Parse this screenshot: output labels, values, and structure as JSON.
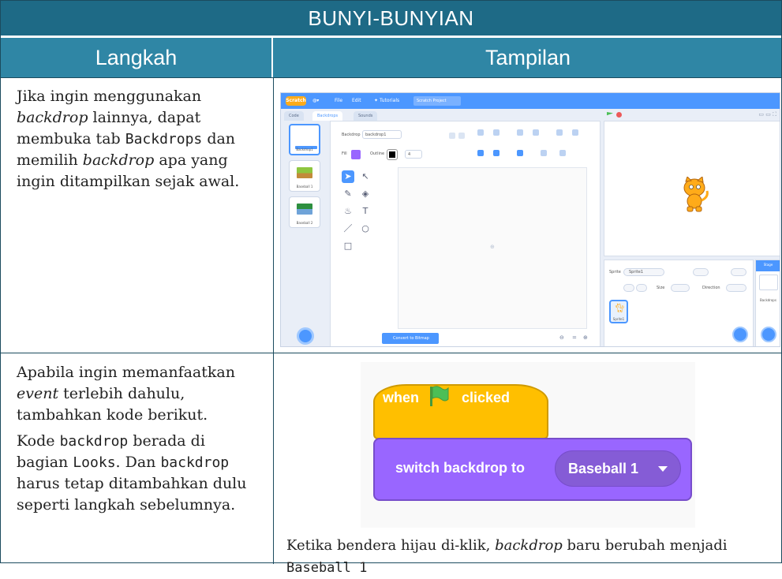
{
  "table": {
    "title": "BUNYI-BUNYIAN",
    "col_step": "Langkah",
    "col_view": "Tampilan"
  },
  "row1": {
    "text_1": "Jika ingin menggunakan ",
    "text_2": "backdrop",
    "text_3": " lainnya, dapat membuka tab ",
    "text_4": "Backdrops",
    "text_5": " dan memilih ",
    "text_6": "backdrop",
    "text_7": " apa yang ingin ditampilkan sejak awal."
  },
  "row2": {
    "p1_1": "Apabila ingin memanfaatkan ",
    "p1_2": "event",
    "p1_3": " terlebih dahulu, tambahkan kode berikut.",
    "p2_1": "Kode ",
    "p2_2": "backdrop",
    "p2_3": " berada di bagian ",
    "p2_4": "Looks",
    "p2_5": ". Dan ",
    "p2_6": "backdrop",
    "p2_7": " harus tetap ditambahkan dulu seperti langkah sebelumnya.",
    "caption_1": "Ketika bendera hijau di-klik, ",
    "caption_2": "backdrop",
    "caption_3": " baru berubah menjadi ",
    "caption_4": "Baseball 1"
  },
  "scratch": {
    "logo": "Scratch",
    "menu_file": "File",
    "menu_edit": "Edit",
    "menu_tutorials": "Tutorials",
    "project_title": "Scratch Project",
    "tab_code": "Code",
    "tab_backdrops": "Backdrops",
    "tab_sounds": "Sounds",
    "thumb_1_label": "Backdrop1",
    "thumb_2_label": "Baseball 1",
    "thumb_3_label": "Baseball 2",
    "backdrop_field_label": "Backdrop",
    "backdrop_name": "backdrop1",
    "fill_label": "Fill",
    "outline_label": "Outline",
    "outline_size": "4",
    "convert_button": "Convert to Bitmap",
    "sprite_label": "Sprite",
    "sprite_name": "Sprite1",
    "size_label": "Size",
    "direction_label": "Direction",
    "sprite_thumb_label": "Sprite1",
    "stage_label": "Stage",
    "backdrops_count_label": "Backdrops"
  },
  "blocks": {
    "hat_when": "when",
    "hat_clicked": "clicked",
    "switch_label": "switch backdrop to",
    "dropdown_value": "Baseball 1",
    "hat_color": "#ffbf00",
    "looks_color": "#9966ff"
  },
  "colors": {
    "title_bg": "#1e6a86",
    "header_bg": "#2f86a5",
    "scratch_blue": "#4c97ff"
  }
}
